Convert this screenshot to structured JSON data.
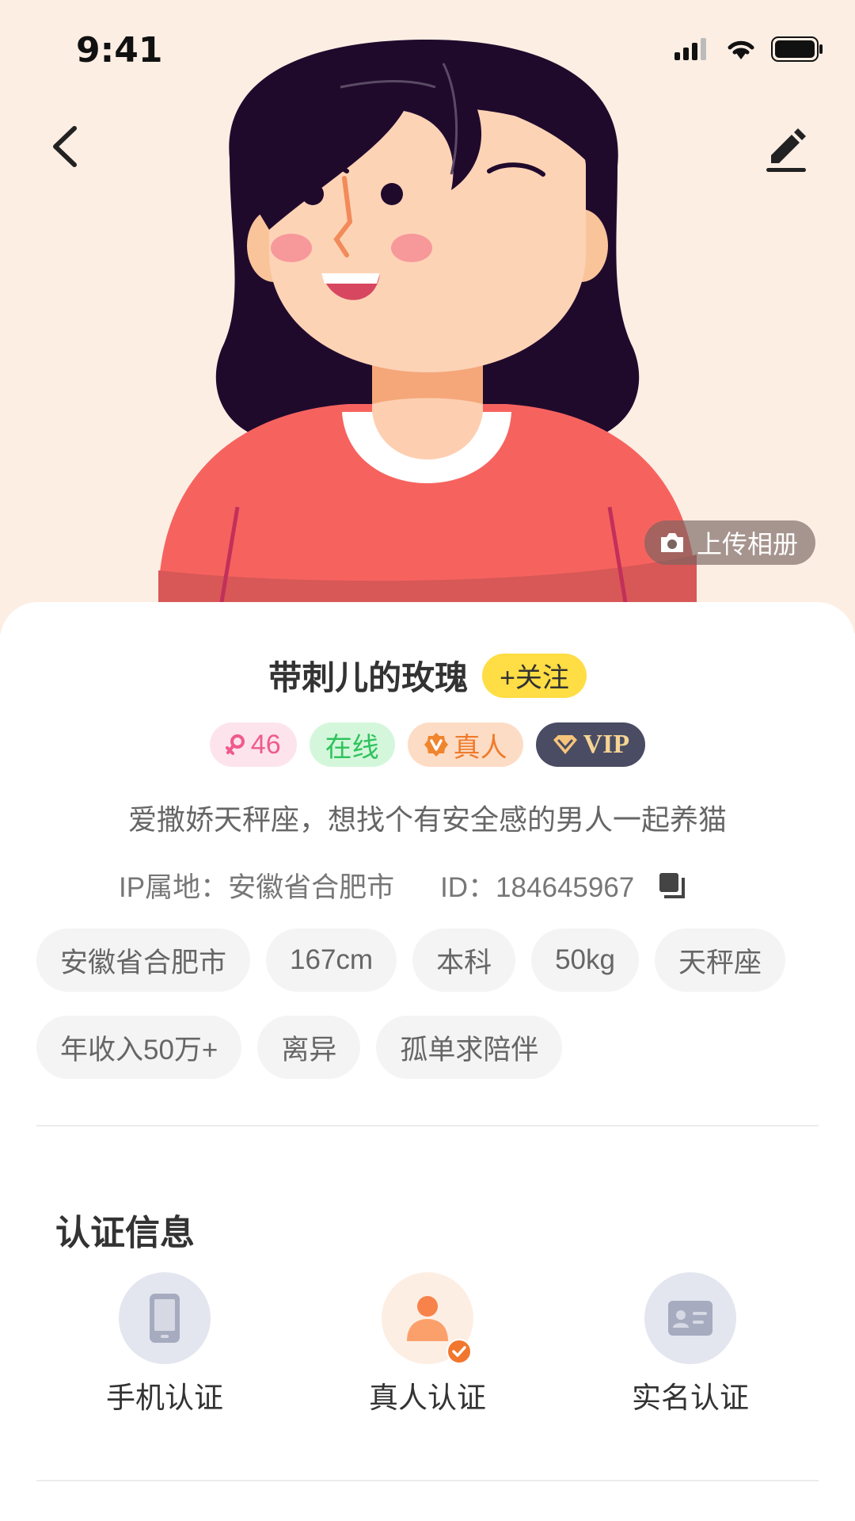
{
  "status_bar": {
    "time": "9:41"
  },
  "profile": {
    "nickname": "带刺儿的玫瑰",
    "follow_label": "+关注",
    "upload_album_label": "上传相册",
    "badges": {
      "age": "46",
      "online": "在线",
      "real": "真人",
      "vip": "VIP"
    },
    "bio": "爱撒娇天秤座，想找个有安全感的男人一起养猫",
    "ip_location": "IP属地：安徽省合肥市",
    "id_text": "ID：184645967",
    "tags_row1": [
      "安徽省合肥市",
      "167cm",
      "本科",
      "50kg",
      "天秤座"
    ],
    "tags_row2": [
      "年收入50万+",
      "离异",
      "孤单求陪伴"
    ]
  },
  "verification": {
    "title": "认证信息",
    "items": [
      {
        "label": "手机认证",
        "icon": "phone-icon"
      },
      {
        "label": "真人认证",
        "icon": "person-icon",
        "verified": true
      },
      {
        "label": "实名认证",
        "icon": "id-card-icon"
      }
    ]
  },
  "colors": {
    "hero_bg": "#fdeee4",
    "follow": "#ffdd44",
    "age_badge": "#f05a8c",
    "online_badge": "#2fc35c",
    "real_badge": "#ef7b2a",
    "vip_badge": "#4a4c63"
  }
}
